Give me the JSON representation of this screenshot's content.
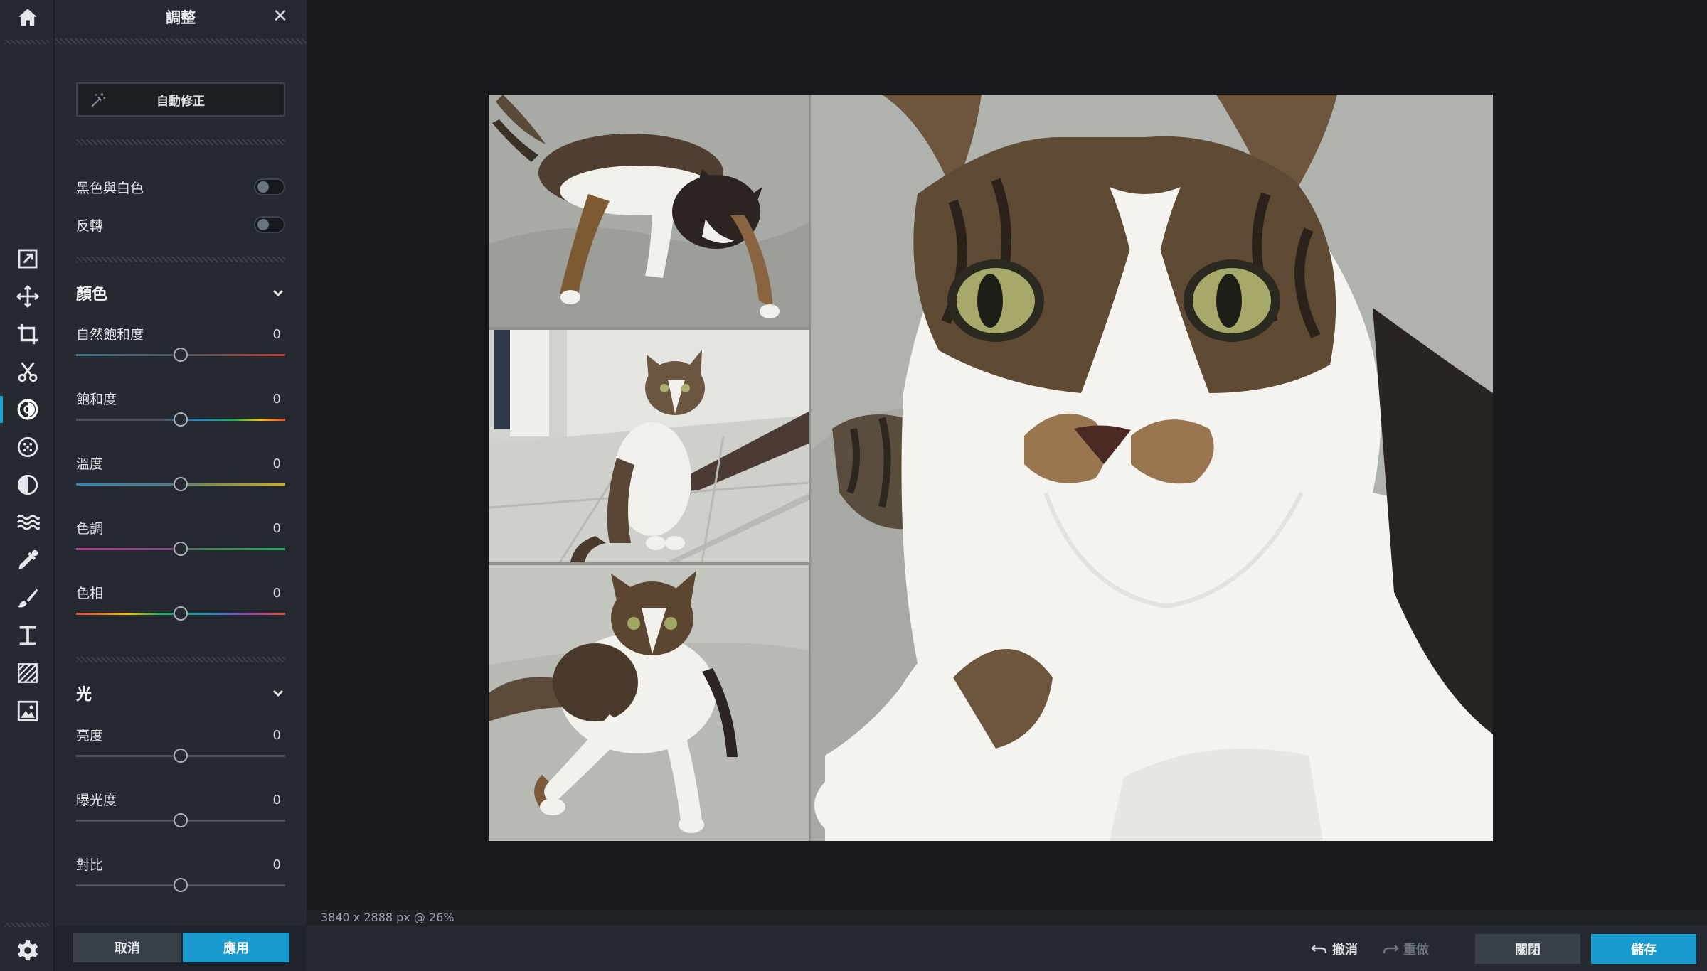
{
  "panel": {
    "title": "調整",
    "close_glyph": "✕",
    "auto_fix_label": "自動修正",
    "toggles": [
      {
        "label": "黑色與白色",
        "on": false
      },
      {
        "label": "反轉",
        "on": false
      }
    ],
    "sections": {
      "color": {
        "title": "顏色",
        "sliders": [
          {
            "label": "自然飽和度",
            "value": "0",
            "position": 0.5
          },
          {
            "label": "飽和度",
            "value": "0",
            "position": 0.5
          },
          {
            "label": "溫度",
            "value": "0",
            "position": 0.5
          },
          {
            "label": "色調",
            "value": "0",
            "position": 0.5
          },
          {
            "label": "色相",
            "value": "0",
            "position": 0.5
          }
        ]
      },
      "light": {
        "title": "光",
        "sliders": [
          {
            "label": "亮度",
            "value": "0",
            "position": 0.5
          },
          {
            "label": "曝光度",
            "value": "0",
            "position": 0.5
          },
          {
            "label": "對比",
            "value": "0",
            "position": 0.5
          }
        ]
      }
    },
    "cancel_label": "取消",
    "apply_label": "應用"
  },
  "rail": {
    "icons": [
      "home-icon",
      "resize-icon",
      "move-icon",
      "crop-icon",
      "cut-icon",
      "adjust-icon",
      "effects-icon",
      "filter-icon",
      "wave-icon",
      "dropper-icon",
      "brush-icon",
      "text-icon",
      "texture-icon",
      "image-icon",
      "settings-icon"
    ],
    "active": "adjust-icon"
  },
  "status": {
    "size_info": "3840 x 2888 px @ 26%"
  },
  "footer": {
    "undo_label": "撤消",
    "redo_label": "重做",
    "close_label": "關閉",
    "save_label": "儲存"
  },
  "colors": {
    "accent": "#1a9bd0",
    "panel_bg": "#252a31",
    "workspace_bg": "#17191d"
  }
}
